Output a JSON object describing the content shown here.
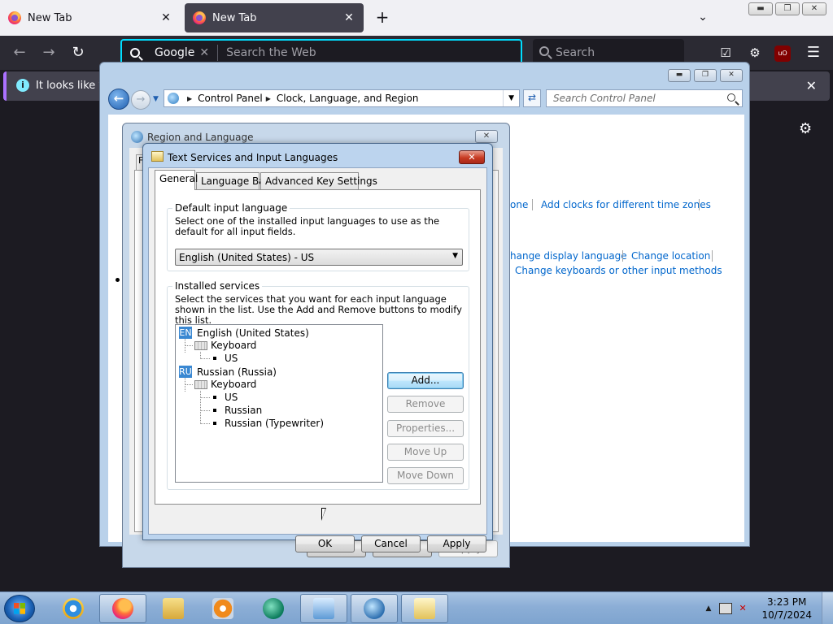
{
  "browser": {
    "tabs": [
      {
        "label": "New Tab",
        "active": false
      },
      {
        "label": "New Tab",
        "active": true
      }
    ],
    "new_tab_glyph": "+",
    "urlbar": {
      "engine": "Google",
      "placeholder": "Search the Web"
    },
    "searchbox": {
      "placeholder": "Search"
    },
    "notification": {
      "text": "It looks like you"
    },
    "close_glyph": "✕"
  },
  "control_panel": {
    "breadcrumb": [
      "Control Panel",
      "Clock, Language, and Region"
    ],
    "search_placeholder": "Search Control Panel",
    "links": {
      "set_timezone_fragment": "one",
      "add_clocks": "Add clocks for different time zones",
      "change_display_language": "hange display language",
      "change_location": "Change location",
      "change_keyboards": "Change keyboards or other input methods"
    }
  },
  "region_dialog": {
    "title": "Region and Language",
    "tab_stub": "F",
    "buttons": {
      "ok": "OK",
      "cancel": "Cancel",
      "apply": "Apply"
    }
  },
  "text_services": {
    "title": "Text Services and Input Languages",
    "tabs": [
      "General",
      "Language Bar",
      "Advanced Key Settings"
    ],
    "default_input": {
      "label": "Default input language",
      "description": "Select one of the installed input languages to use as the default for all input fields.",
      "selected": "English (United States) - US"
    },
    "installed": {
      "label": "Installed services",
      "description": "Select the services that you want for each input language shown in the list. Use the Add and Remove buttons to modify this list.",
      "languages": [
        {
          "code": "EN",
          "name": "English (United States)",
          "group": "Keyboard",
          "layouts": [
            "US"
          ]
        },
        {
          "code": "RU",
          "name": "Russian (Russia)",
          "group": "Keyboard",
          "layouts": [
            "US",
            "Russian",
            "Russian (Typewriter)"
          ]
        }
      ]
    },
    "side_buttons": {
      "add": "Add...",
      "remove": "Remove",
      "properties": "Properties...",
      "move_up": "Move Up",
      "move_down": "Move Down"
    },
    "footer_buttons": {
      "ok": "OK",
      "cancel": "Cancel",
      "apply": "Apply"
    }
  },
  "taskbar": {
    "clock_time": "3:23 PM",
    "clock_date": "10/7/2024"
  }
}
